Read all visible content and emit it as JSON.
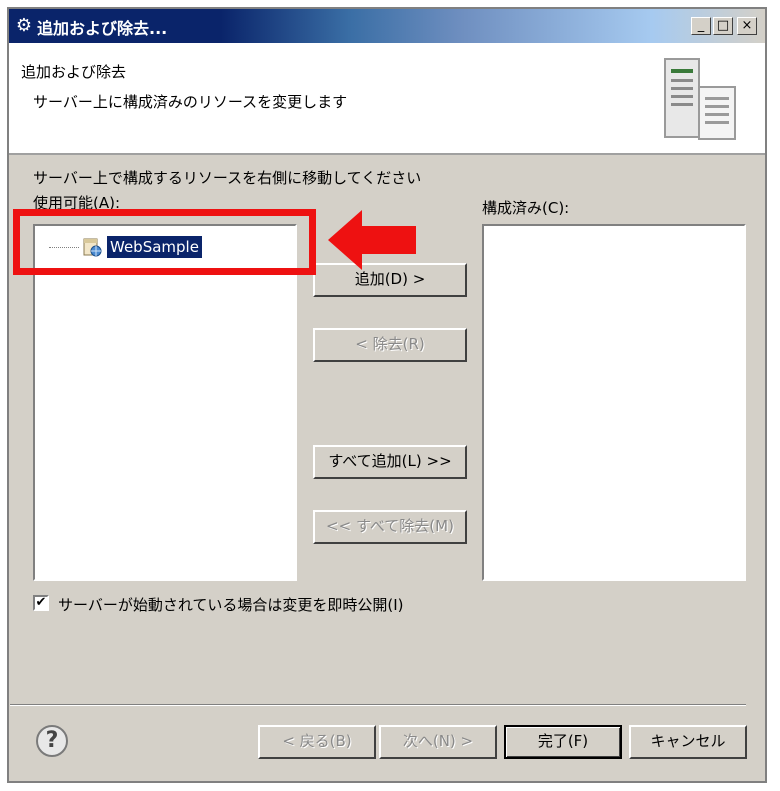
{
  "window": {
    "title": "追加および除去...",
    "controls": {
      "minimize": "_",
      "maximize": "□",
      "close": "×"
    }
  },
  "banner": {
    "title": "追加および除去",
    "description": "サーバー上に構成済みのリソースを変更します",
    "icon": "server-illustration"
  },
  "instruction": "サーバー上で構成するリソースを右側に移動してください",
  "available": {
    "label": "使用可能(A):",
    "items": [
      {
        "label": "WebSample",
        "selected": true,
        "icon": "web-project-icon"
      }
    ]
  },
  "configured": {
    "label": "構成済み(C):",
    "items": []
  },
  "buttons": {
    "add": "追加(D) >",
    "remove": "< 除去(R)",
    "add_all": "すべて追加(L) >>",
    "remove_all": "<< すべて除去(M)"
  },
  "checkbox": {
    "label": "サーバーが始動されている場合は変更を即時公開(I)",
    "checked": true,
    "mark": "✔"
  },
  "footer": {
    "help": "?",
    "back": "< 戻る(B)",
    "next": "次へ(N) >",
    "finish": "完了(F)",
    "cancel": "キャンセル"
  },
  "annotation_color": "#ee1111"
}
